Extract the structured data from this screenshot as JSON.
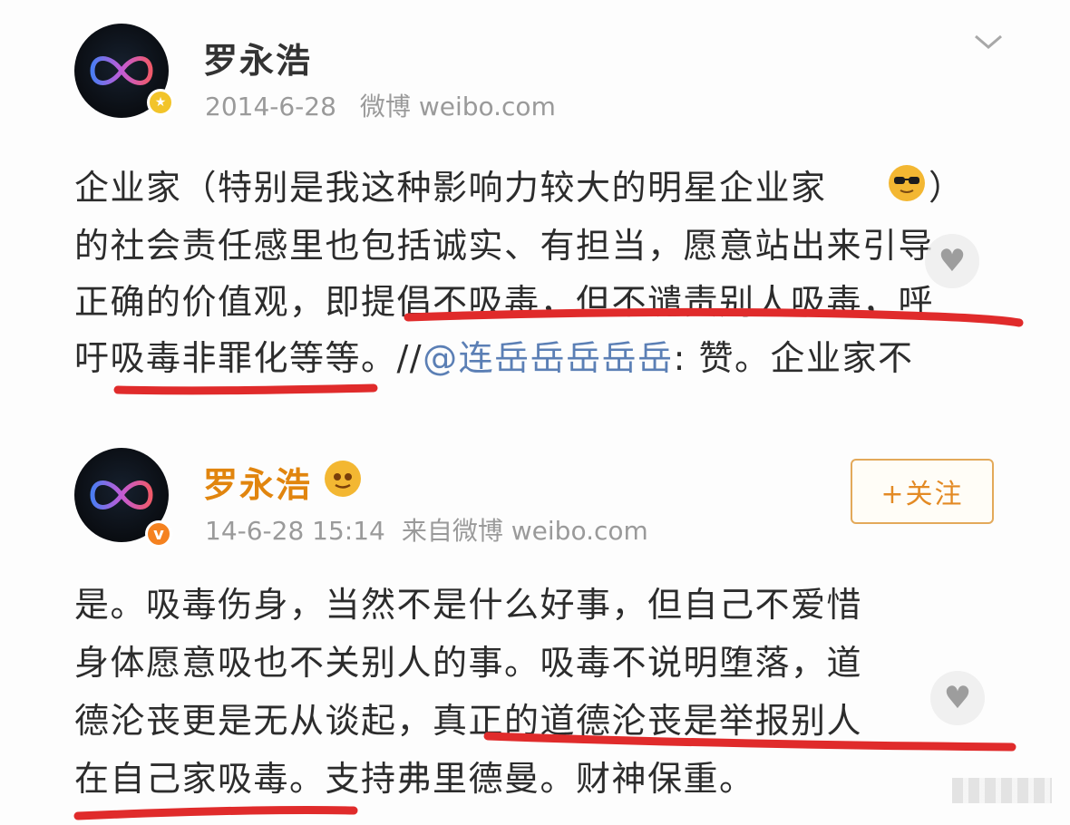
{
  "post1": {
    "username": "罗永浩",
    "date": "2014-6-28",
    "source": "微博 weibo.com",
    "lines": [
      "企业家（特别是我这种影响力较大的明星企业家",
      "的社会责任感里也包括诚实、有担当，愿意站出来引导",
      "正确的价值观，即提倡不吸毒，但不谴责别人吸毒，呼",
      "吁吸毒非罪化等等。//"
    ],
    "line1_close": "）",
    "mention": "@连岳岳岳岳岳",
    "after_mention": ": 赞。企业家不",
    "badge_icon": "gold-verified-badge",
    "menu_icon": "chevron-down-icon"
  },
  "post2": {
    "username": "罗永浩",
    "date_time": "14-6-28 15:14",
    "source": "来自微博 weibo.com",
    "follow_label": "+关注",
    "lines": [
      "是。吸毒伤身，当然不是什么好事，但自己不爱惜",
      "身体愿意吸也不关别人的事。吸毒不说明堕落，道",
      "德沦丧更是无从谈起，真正的道德沦丧是举报别人",
      "在自己家吸毒。支持弗里德曼。财神保重。"
    ],
    "badge_letter": "v",
    "badge_icon": "orange-verified-badge"
  },
  "colors": {
    "underline": "#e02b2b",
    "mention": "#5b7fb5",
    "follow": "#e38a24",
    "username_orange": "#e1850e"
  }
}
